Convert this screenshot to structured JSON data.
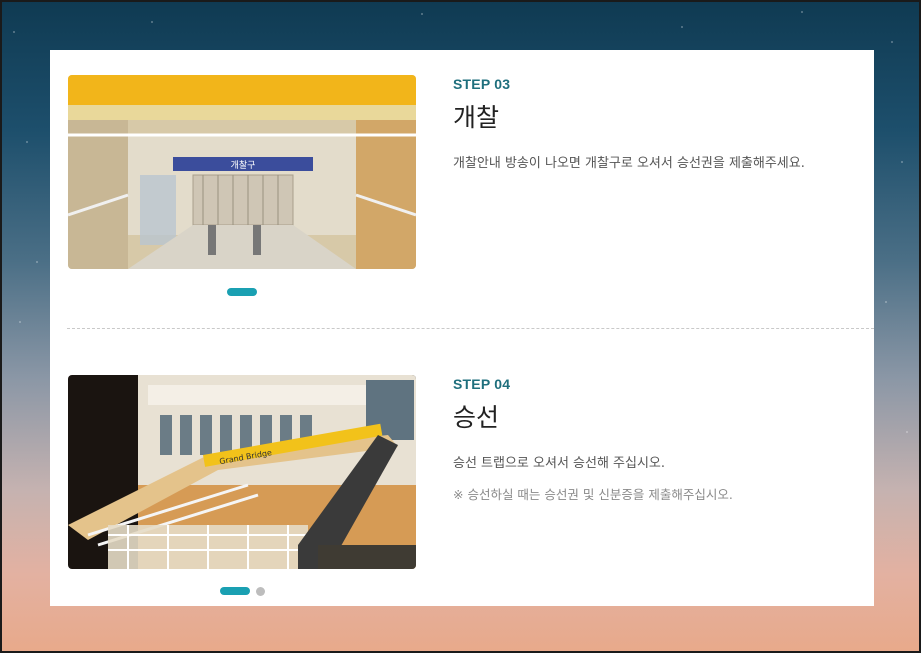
{
  "steps": [
    {
      "label": "STEP 03",
      "title": "개찰",
      "description": "개찰안내 방송이 나오면 개찰구로 오셔서 승선권을 제출해주세요.",
      "slider": {
        "total": 1,
        "active": 1
      },
      "photo_sign_text": "개찰구"
    },
    {
      "label": "STEP 04",
      "title": "승선",
      "description": "승선 트랩으로 오셔서 승선해 주십시오.",
      "note": "※ 승선하실 때는 승선권 및 신분증을 제출해주십시오.",
      "slider": {
        "total": 2,
        "active": 1
      },
      "photo_banner_text": "Grand Bridge"
    }
  ],
  "colors": {
    "accent": "#1aa0b2",
    "label": "#1f6f7d",
    "inactive_dot": "#bdbdbd"
  }
}
